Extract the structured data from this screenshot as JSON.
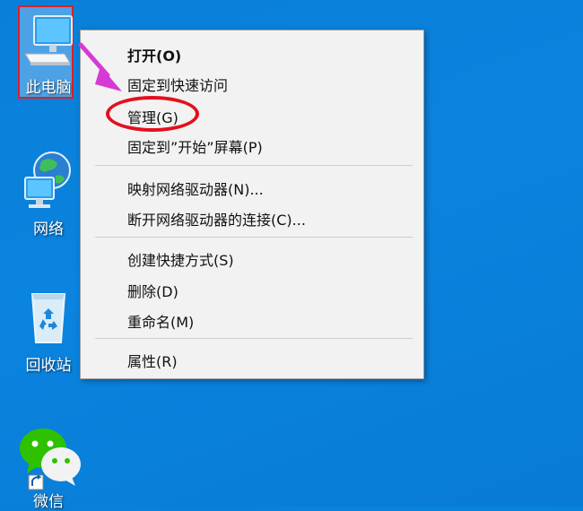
{
  "desktop": {
    "icons": [
      {
        "label": "此电脑",
        "icon": "this-pc-icon"
      },
      {
        "label": "网络",
        "icon": "network-icon"
      },
      {
        "label": "回收站",
        "icon": "recycle-bin-icon"
      },
      {
        "label": "微信",
        "icon": "wechat-icon"
      }
    ]
  },
  "context_menu": {
    "items": [
      {
        "label": "打开(O)"
      },
      {
        "label": "固定到快速访问"
      },
      {
        "label": "管理(G)"
      },
      {
        "label": "固定到”开始”屏幕(P)"
      },
      {
        "label": "映射网络驱动器(N)..."
      },
      {
        "label": "断开网络驱动器的连接(C)..."
      },
      {
        "label": "创建快捷方式(S)"
      },
      {
        "label": "删除(D)"
      },
      {
        "label": "重命名(M)"
      },
      {
        "label": "属性(R)"
      }
    ]
  },
  "annotations": {
    "highlight_color": "#e3101e",
    "arrow_color": "#d63ad6"
  }
}
